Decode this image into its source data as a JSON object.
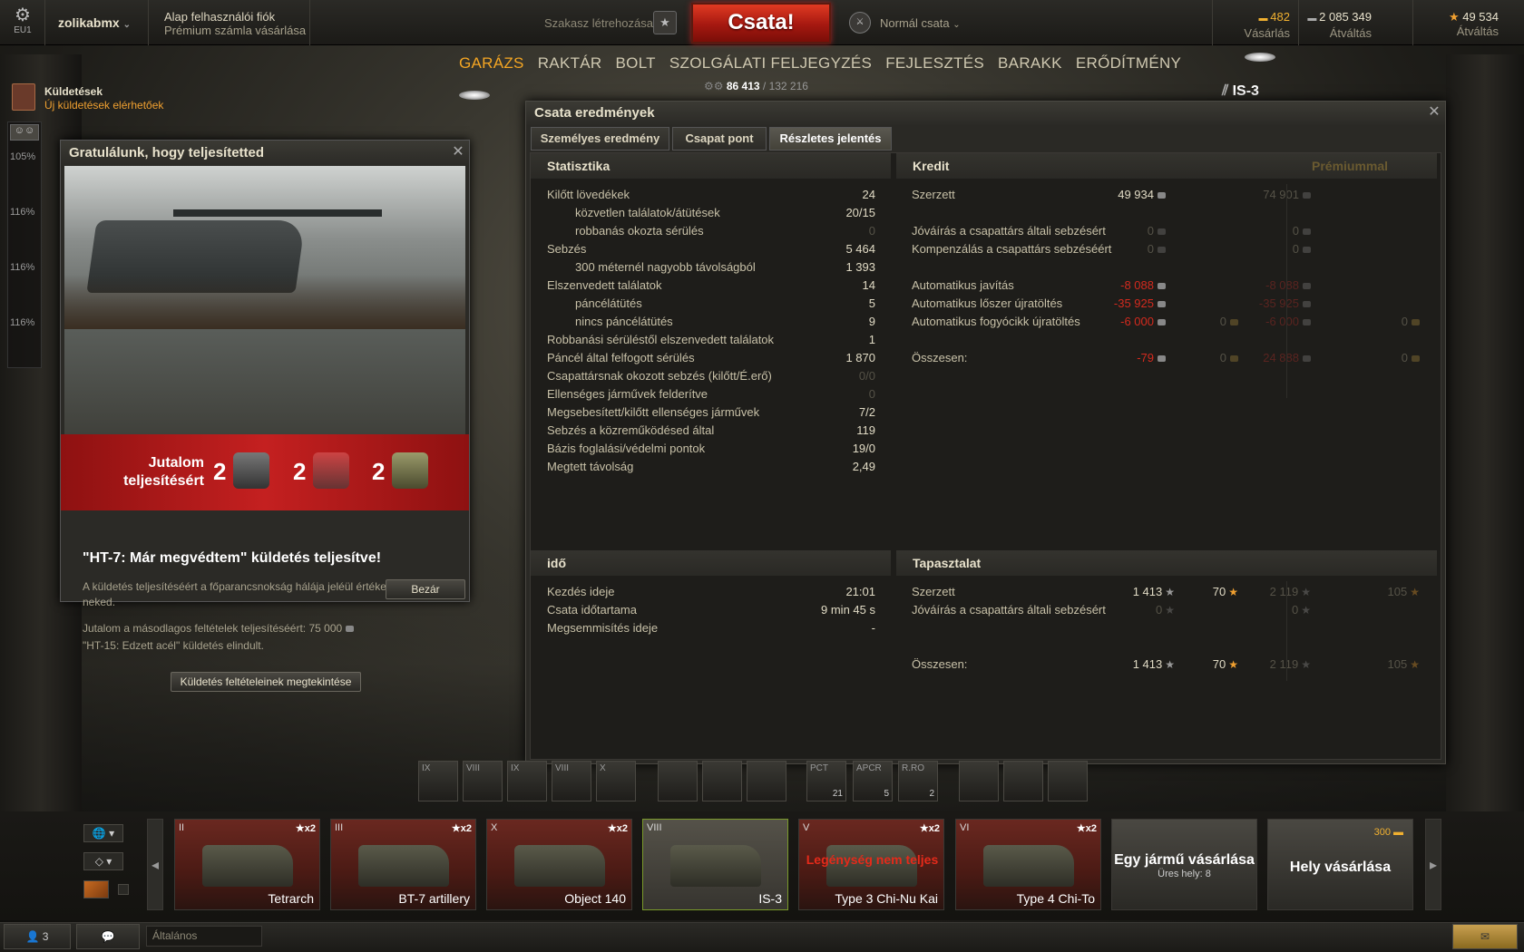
{
  "topbar": {
    "server": "EU1",
    "username": "zolikabmx",
    "account_line1": "Alap felhasználói fiók",
    "account_line2": "Prémium számla vásárlása",
    "squad": "Szakasz létrehozása",
    "battle_button": "Csata!",
    "battle_mode": "Normál csata",
    "gold_value": "482",
    "gold_label": "Vásárlás",
    "credits_value": "2 085 349",
    "credits_label": "Átváltás",
    "xp_value": "49 534",
    "xp_label": "Átváltás"
  },
  "nav": {
    "items": [
      "GARÁZS",
      "RAKTÁR",
      "BOLT",
      "SZOLGÁLATI FELJEGYZÉS",
      "FEJLESZTÉS",
      "BARAKK",
      "ERŐDÍTMÉNY"
    ],
    "active": "GARÁZS",
    "xp_current": "86 413",
    "xp_total": "/ 132 216"
  },
  "missions": {
    "title": "Küldetések",
    "subtitle": "Új küldetések elérhetőek"
  },
  "sidebar": {
    "items": [
      "105%",
      "116%",
      "116%",
      "116%"
    ]
  },
  "vehicle_label": "IS-3",
  "popup": {
    "title": "Gratulálunk, hogy teljesítetted",
    "reward_label_1": "Jutalom",
    "reward_label_2": "teljesítésért",
    "rewards": [
      "2",
      "2",
      "2"
    ],
    "mission_title": "\"HT-7: Már megvédtem\" küldetés teljesítve!",
    "description": "A küldetés teljesítéséért a főparancsnokság hálája jeléül értékes jutalmat ad neked.",
    "secondary": "Jutalom a másodlagos feltételek teljesítéséért: 75 000",
    "next": "\"HT-15: Edzett acél\" küldetés elindult.",
    "view_button": "Küldetés feltételeinek megtekintése",
    "close_button": "Bezár"
  },
  "results": {
    "title": "Csata eredmények",
    "tabs": [
      "Személyes eredmény",
      "Csapat pont",
      "Részletes jelentés"
    ],
    "stats_header": "Statisztika",
    "stats": [
      {
        "label": "Kilőtt lövedékek",
        "value": "24"
      },
      {
        "label": "közvetlen találatok/átütések",
        "value": "20/15"
      },
      {
        "label": "robbanás okozta sérülés",
        "value": "0"
      },
      {
        "label": "Sebzés",
        "value": "5 464"
      },
      {
        "label": "300 méternél nagyobb távolságból",
        "value": "1 393"
      },
      {
        "label": "Elszenvedett találatok",
        "value": "14"
      },
      {
        "label": "páncélátütés",
        "value": "5"
      },
      {
        "label": "nincs páncélátütés",
        "value": "9"
      },
      {
        "label": "Robbanási sérüléstől elszenvedett találatok",
        "value": "1"
      },
      {
        "label": "Páncél által felfogott sérülés",
        "value": "1 870"
      },
      {
        "label": "Csapattársnak okozott sebzés (kilőtt/É.erő)",
        "value": "0/0"
      },
      {
        "label": "Ellenséges járművek felderítve",
        "value": "0"
      },
      {
        "label": "Megsebesített/kilőtt ellenséges járművek",
        "value": "7/2"
      },
      {
        "label": "Sebzés a közreműködésed által",
        "value": "119"
      },
      {
        "label": "Bázis foglalási/védelmi pontok",
        "value": "19/0"
      },
      {
        "label": "Megtett távolság",
        "value": "2,49"
      }
    ],
    "credit_header": "Kredit",
    "premium_header": "Prémiummal",
    "credit_rows": [
      {
        "label": "Szerzett",
        "c": "49 934",
        "g": "",
        "pc": "74 901",
        "pg": ""
      },
      {
        "label": "Jóváírás a csapattárs általi sebzésért",
        "c": "0",
        "g": "",
        "pc": "0",
        "pg": ""
      },
      {
        "label": "Kompenzálás a csapattárs sebzéséért",
        "c": "0",
        "g": "",
        "pc": "0",
        "pg": ""
      },
      {
        "label": "Automatikus javítás",
        "c": "-8 088",
        "g": "",
        "pc": "-8 088",
        "pg": ""
      },
      {
        "label": "Automatikus lőszer újratöltés",
        "c": "-35 925",
        "g": "",
        "pc": "-35 925",
        "pg": ""
      },
      {
        "label": "Automatikus fogyócikk újratöltés",
        "c": "-6 000",
        "g": "0",
        "pc": "-6 000",
        "pg": "0"
      },
      {
        "label": "Összesen:",
        "c": "-79",
        "g": "0",
        "pc": "24 888",
        "pg": "0"
      }
    ],
    "time_header": "idő",
    "time_rows": [
      {
        "label": "Kezdés ideje",
        "value": "21:01"
      },
      {
        "label": "Csata időtartama",
        "value": "9 min 45 s"
      },
      {
        "label": "Megsemmisítés ideje",
        "value": "-"
      }
    ],
    "xp_header": "Tapasztalat",
    "xp_rows": [
      {
        "label": "Szerzett",
        "xp": "1 413",
        "fxp": "70",
        "pxp": "2 119",
        "pfxp": "105"
      },
      {
        "label": "Jóváírás a csapattárs általi sebzésért",
        "xp": "0",
        "fxp": "",
        "pxp": "0",
        "pfxp": ""
      },
      {
        "label": "Összesen:",
        "xp": "1 413",
        "fxp": "70",
        "pxp": "2 119",
        "pfxp": "105"
      }
    ]
  },
  "slots": {
    "modules": [
      "IX",
      "VIII",
      "IX",
      "VIII",
      "X"
    ],
    "consumables": [
      {
        "label": "PCT",
        "count": "21"
      },
      {
        "label": "APCR",
        "count": "5"
      },
      {
        "label": "R.RO",
        "count": "2"
      }
    ]
  },
  "carousel": {
    "tanks": [
      {
        "tier": "II",
        "name": "Tetrarch",
        "x2": "x2"
      },
      {
        "tier": "III",
        "name": "BT-7 artillery",
        "x2": "x2"
      },
      {
        "tier": "X",
        "name": "Object 140",
        "x2": "x2"
      },
      {
        "tier": "VIII",
        "name": "IS-3",
        "x2": ""
      },
      {
        "tier": "V",
        "name": "Type 3 Chi-Nu Kai",
        "x2": "x2",
        "warning": "Legénység nem teljes"
      },
      {
        "tier": "VI",
        "name": "Type 4 Chi-To",
        "x2": "x2"
      }
    ],
    "buy_vehicle": "Egy jármű vásárlása",
    "buy_vehicle_sub": "Üres hely: 8",
    "buy_slot": "Hely vásárlása",
    "buy_slot_price": "300"
  },
  "bottombar": {
    "players": "3",
    "chat_channel": "Általános"
  }
}
